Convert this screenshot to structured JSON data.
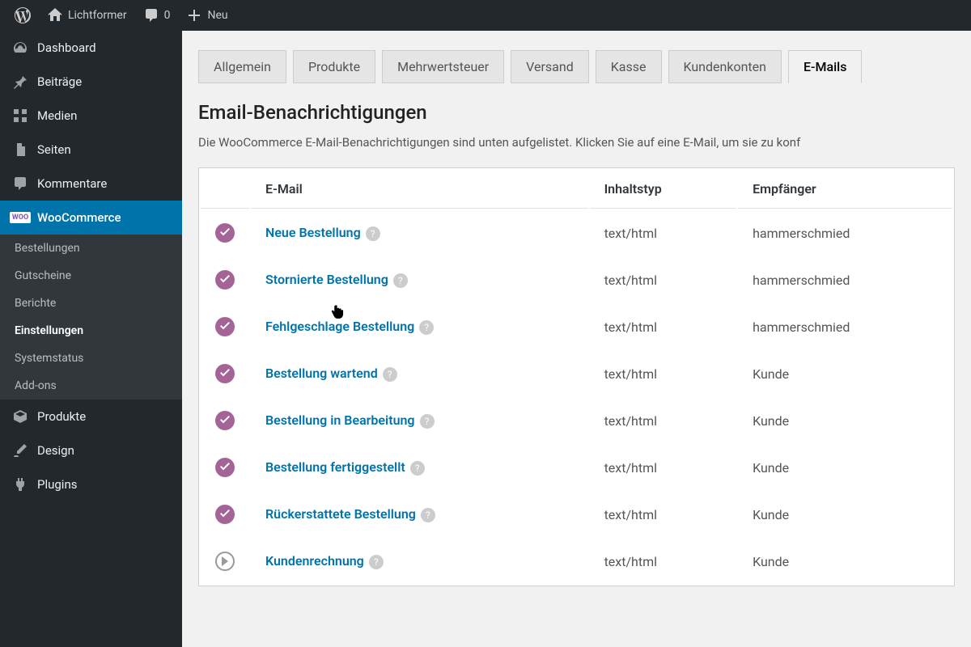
{
  "topbar": {
    "site_name": "Lichtformer",
    "comments_count": "0",
    "new_label": "Neu"
  },
  "sidebar": {
    "dashboard": "Dashboard",
    "posts": "Beiträge",
    "media": "Medien",
    "pages": "Seiten",
    "comments": "Kommentare",
    "woocommerce": "WooCommerce",
    "woo_badge": "WOO",
    "submenu": {
      "orders": "Bestellungen",
      "coupons": "Gutscheine",
      "reports": "Berichte",
      "settings": "Einstellungen",
      "status": "Systemstatus",
      "addons": "Add-ons"
    },
    "products": "Produkte",
    "design": "Design",
    "plugins": "Plugins"
  },
  "tabs": {
    "general": "Allgemein",
    "products": "Produkte",
    "tax": "Mehrwertsteuer",
    "shipping": "Versand",
    "checkout": "Kasse",
    "accounts": "Kundenkonten",
    "emails": "E-Mails"
  },
  "section": {
    "heading": "Email-Benachrichtigungen",
    "description": "Die WooCommerce E-Mail-Benachrichtigungen sind unten aufgelistet. Klicken Sie auf eine E-Mail, um sie zu konf"
  },
  "table": {
    "headers": {
      "email": "E-Mail",
      "content_type": "Inhaltstyp",
      "recipient": "Empfänger"
    },
    "rows": [
      {
        "status": "enabled",
        "name": "Neue Bestellung",
        "content_type": "text/html",
        "recipient": "hammerschmied"
      },
      {
        "status": "enabled",
        "name": "Stornierte Bestellung",
        "content_type": "text/html",
        "recipient": "hammerschmied"
      },
      {
        "status": "enabled",
        "name": "Fehlgeschlage Bestellung",
        "content_type": "text/html",
        "recipient": "hammerschmied"
      },
      {
        "status": "enabled",
        "name": "Bestellung wartend",
        "content_type": "text/html",
        "recipient": "Kunde"
      },
      {
        "status": "enabled",
        "name": "Bestellung in Bearbeitung",
        "content_type": "text/html",
        "recipient": "Kunde"
      },
      {
        "status": "enabled",
        "name": "Bestellung fertiggestellt",
        "content_type": "text/html",
        "recipient": "Kunde"
      },
      {
        "status": "enabled",
        "name": "Rückerstattete Bestellung",
        "content_type": "text/html",
        "recipient": "Kunde"
      },
      {
        "status": "manual",
        "name": "Kundenrechnung",
        "content_type": "text/html",
        "recipient": "Kunde"
      }
    ]
  }
}
